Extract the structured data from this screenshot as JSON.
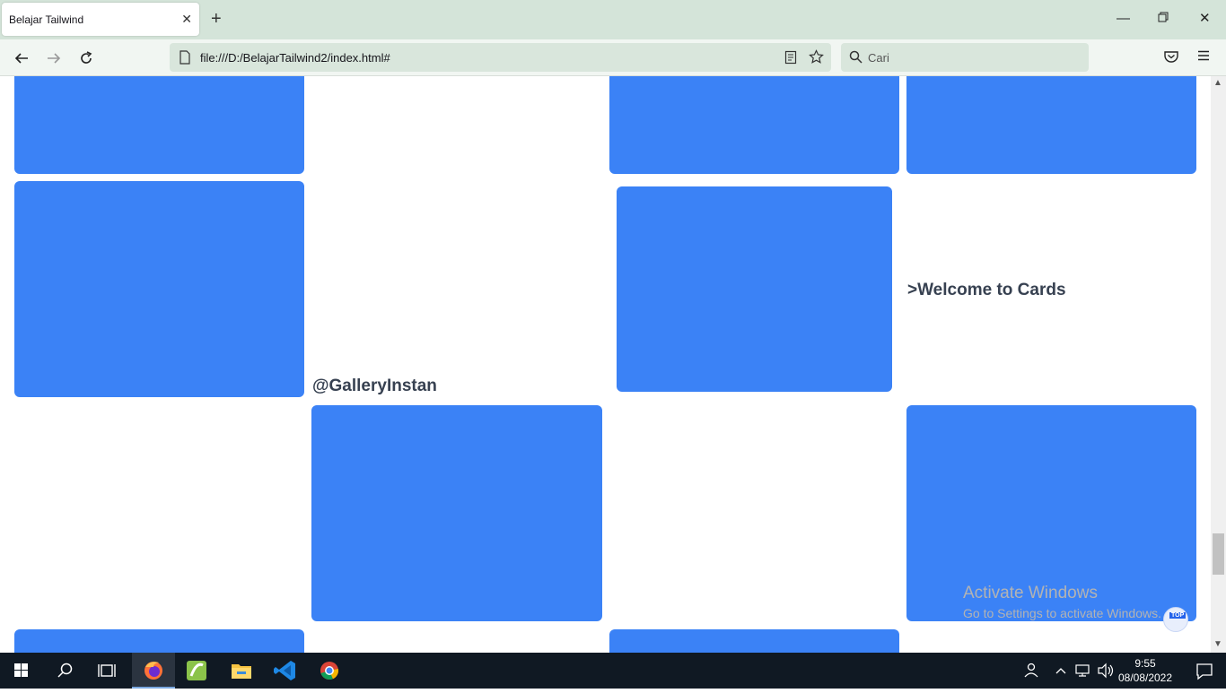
{
  "browser": {
    "tab_title": "Belajar Tailwind",
    "url": "file:///D:/BelajarTailwind2/index.html#",
    "search_placeholder": "Cari"
  },
  "page": {
    "heading_gallery": "@GalleryInstan",
    "heading_welcome": ">Welcome to Cards",
    "card_color": "#3b82f6",
    "top_button_label": "TOP"
  },
  "watermark": {
    "line1": "Activate Windows",
    "line2": "Go to Settings to activate Windows."
  },
  "taskbar": {
    "time": "9:55",
    "date": "08/08/2022",
    "apps": [
      "firefox-icon",
      "app-green-icon",
      "file-explorer-icon",
      "vscode-icon",
      "chrome-icon"
    ]
  }
}
